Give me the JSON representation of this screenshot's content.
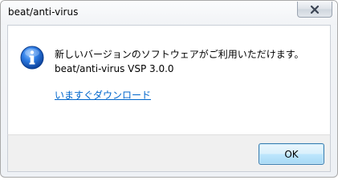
{
  "window": {
    "title": "beat/anti-virus"
  },
  "titlebar": {
    "close_icon": "close-icon"
  },
  "dialog": {
    "icon": "info-icon",
    "message_line1": "新しいバージョンのソフトウェアがご利用いただけます。",
    "message_line2": "beat/anti-virus VSP 3.0.0",
    "link_text": "いますぐダウンロード",
    "ok_label": "OK"
  },
  "colors": {
    "link": "#0066cc",
    "info_icon_blue": "#1f5fbf",
    "close_x": "#ffffff"
  }
}
